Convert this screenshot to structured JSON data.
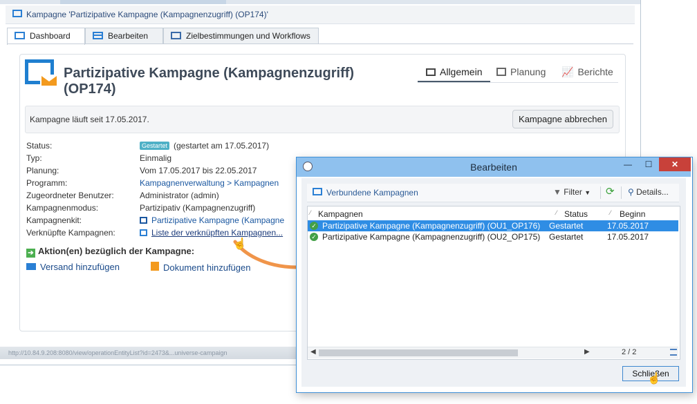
{
  "window": {
    "title": "Kampagne 'Partizipative Kampagne (Kampagnenzugriff) (OP174)'",
    "tabs": [
      {
        "label": "Dashboard"
      },
      {
        "label": "Bearbeiten"
      },
      {
        "label": "Zielbestimmungen und Workflows"
      }
    ]
  },
  "campaign": {
    "title": "Partizipative Kampagne (Kampagnenzugriff) (OP174)",
    "view_tabs": [
      "Allgemein",
      "Planung",
      "Berichte"
    ],
    "running_since": "Kampagne läuft seit 17.05.2017.",
    "cancel_button": "Kampagne abbrechen",
    "fields": [
      {
        "label": "Status:",
        "badge": "Gestartet",
        "value": "(gestartet am 17.05.2017)"
      },
      {
        "label": "Typ:",
        "value": "Einmalig"
      },
      {
        "label": "Planung:",
        "value": "Vom 17.05.2017 bis 22.05.2017"
      },
      {
        "label": "Programm:",
        "value": "Kampagnenverwaltung > Kampagnen"
      },
      {
        "label": "Zugeordneter Benutzer:",
        "value": "Administrator (admin)"
      },
      {
        "label": "Kampagnenmodus:",
        "value": "Partizipativ (Kampagnenzugriff)"
      },
      {
        "label": "Kampagnenkit:",
        "value": "Partizipative Kampagne (Kampagne"
      },
      {
        "label": "Verknüpfte Kampagnen:",
        "value": "Liste der verknüpften Kampagnen..."
      }
    ],
    "actions_heading": "Aktion(en) bezüglich der Kampagne:",
    "actions": [
      "Versand hinzufügen",
      "Dokument hinzufügen"
    ],
    "status_url": "http://10.84.9.208:8080/view/operationEntityList?id=2473&...universe-campaign"
  },
  "dialog": {
    "title": "Bearbeiten",
    "toolbar_label": "Verbundene Kampagnen",
    "filter_label": "Filter",
    "details_label": "Details...",
    "columns": [
      "Kampagnen",
      "Status",
      "Beginn"
    ],
    "rows": [
      {
        "name": "Partizipative Kampagne (Kampagnenzugriff)  (OU1_OP176)",
        "status": "Gestartet",
        "start": "17.05.2017"
      },
      {
        "name": "Partizipative Kampagne (Kampagnenzugriff)  (OU2_OP175)",
        "status": "Gestartet",
        "start": "17.05.2017"
      }
    ],
    "count": "2 / 2",
    "close_button": "Schließen"
  },
  "colors": {
    "accent": "#2a7fd4",
    "selection": "#2f8de4",
    "arrow": "#f0954a",
    "badge": "#4eb0c6"
  }
}
